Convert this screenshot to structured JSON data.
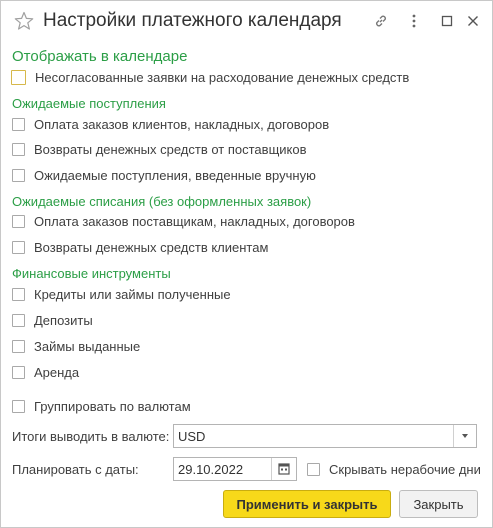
{
  "window": {
    "title": "Настройки платежного календаря"
  },
  "sections": {
    "display": "Отображать в календаре",
    "expected_income": "Ожидаемые поступления",
    "expected_writeoffs": "Ожидаемые списания (без оформленных заявок)",
    "financial_instruments": "Финансовые инструменты"
  },
  "checkboxes": {
    "unapproved_requests": {
      "label": "Несогласованные заявки на расходование денежных средств",
      "checked": false
    },
    "customer_orders": {
      "label": "Оплата заказов клиентов, накладных, договоров",
      "checked": false
    },
    "supplier_refunds": {
      "label": "Возвраты денежных средств от поставщиков",
      "checked": false
    },
    "manual_income": {
      "label": "Ожидаемые поступления, введенные вручную",
      "checked": false
    },
    "supplier_orders": {
      "label": "Оплата заказов поставщикам, накладных, договоров",
      "checked": false
    },
    "customer_refunds": {
      "label": "Возвраты денежных средств клиентам",
      "checked": false
    },
    "loans_received": {
      "label": "Кредиты или займы полученные",
      "checked": false
    },
    "deposits": {
      "label": "Депозиты",
      "checked": false
    },
    "loans_issued": {
      "label": "Займы выданные",
      "checked": false
    },
    "lease": {
      "label": "Аренда",
      "checked": false
    },
    "group_by_currency": {
      "label": "Группировать по валютам",
      "checked": false
    },
    "hide_nonworking": {
      "label": "Скрывать нерабочие дни",
      "checked": false
    }
  },
  "currency": {
    "label": "Итоги выводить в валюте:",
    "value": "USD"
  },
  "plan_date": {
    "label": "Планировать с даты:",
    "value": "29.10.2022"
  },
  "buttons": {
    "apply_close": "Применить и закрыть",
    "close": "Закрыть"
  }
}
